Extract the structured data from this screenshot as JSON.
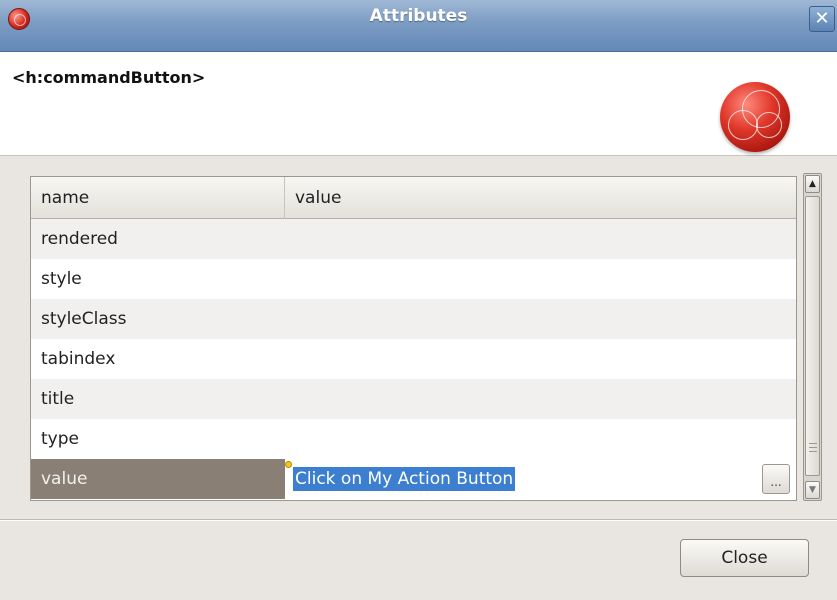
{
  "window": {
    "title": "Attributes",
    "close_glyph": "✕"
  },
  "header": {
    "component_name": "<h:commandButton>"
  },
  "table": {
    "columns": {
      "name": "name",
      "value": "value"
    },
    "rows": [
      {
        "name": "rendered",
        "value": ""
      },
      {
        "name": "style",
        "value": ""
      },
      {
        "name": "styleClass",
        "value": ""
      },
      {
        "name": "tabindex",
        "value": ""
      },
      {
        "name": "title",
        "value": ""
      },
      {
        "name": "type",
        "value": ""
      },
      {
        "name": "value",
        "value": "Click on My Action Button",
        "selected": true
      }
    ],
    "ellipsis_label": "..."
  },
  "scrollbar": {
    "up_glyph": "▲",
    "down_glyph": "▼"
  },
  "footer": {
    "close_label": "Close"
  },
  "colors": {
    "titlebar": "#7c9cc3",
    "selected_row": "#8a7f75",
    "selection_highlight": "#3c7fd0"
  }
}
